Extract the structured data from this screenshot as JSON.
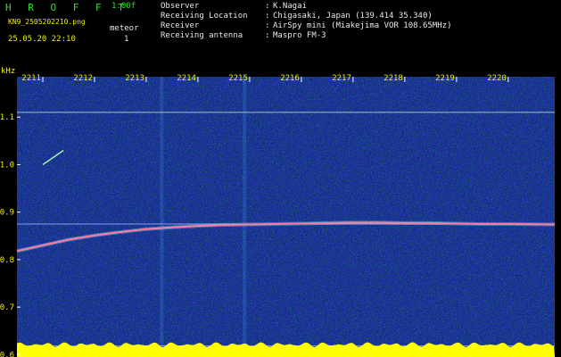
{
  "header": {
    "brand": "H R O F F T",
    "version": "1.00f",
    "filename": "KN9_2505202210.png",
    "meteor_label": "meteor",
    "datetime": "25.05.20 22:10",
    "meteor_count": "1",
    "info": [
      {
        "label": "Observer",
        "value": "K.Nagai"
      },
      {
        "label": "Receiving Location",
        "value": "Chigasaki, Japan (139.414 35.340)"
      },
      {
        "label": "Receiver",
        "value": "AirSpy mini (Miakejima VOR 108.65MHz)"
      },
      {
        "label": "Receiving antenna",
        "value": "Maspro FM-3"
      }
    ],
    "separator": ":"
  },
  "colors": {
    "header_green": "#22e822",
    "header_yellow": "#f0f000",
    "background": "#000000",
    "spectrogram_base": "#1a2a9a",
    "signal_line": "#ff7aa0",
    "power_bar": "#ffff00"
  },
  "chart_data": {
    "type": "heatmap",
    "title": "",
    "ylabel": "kHz",
    "xlabel": "",
    "x_ticks": [
      "2211",
      "2212",
      "2213",
      "2214",
      "2215",
      "2216",
      "2217",
      "2218",
      "2219",
      "2220"
    ],
    "y_ticks": [
      "1.1",
      "1.0",
      "0.9",
      "0.8",
      "0.7",
      "0.6"
    ],
    "y_tick_values": [
      1.1,
      1.0,
      0.9,
      0.8,
      0.7,
      0.6
    ],
    "ylim": [
      0.595,
      1.185
    ],
    "xlim_minutes": [
      2210.5,
      2220.9
    ],
    "horizontal_lines_khz": [
      1.11,
      0.875,
      0.618
    ],
    "vertical_artifacts_minutes": [
      2213.3,
      2214.9
    ],
    "signal_trace": {
      "x": [
        2210.5,
        2211.0,
        2211.5,
        2212.0,
        2212.5,
        2213.0,
        2213.5,
        2214.0,
        2214.5,
        2215.0,
        2215.5,
        2216.0,
        2216.5,
        2217.0,
        2217.5,
        2218.0,
        2218.5,
        2219.0,
        2219.5,
        2220.0,
        2220.9
      ],
      "y": [
        0.818,
        0.83,
        0.842,
        0.851,
        0.858,
        0.864,
        0.868,
        0.871,
        0.873,
        0.874,
        0.875,
        0.876,
        0.877,
        0.878,
        0.878,
        0.877,
        0.877,
        0.876,
        0.875,
        0.875,
        0.874
      ]
    },
    "meteor_trace": {
      "x": [
        2211.0,
        2211.4
      ],
      "y": [
        1.0,
        1.03
      ]
    },
    "grid": false,
    "legend": "none"
  }
}
